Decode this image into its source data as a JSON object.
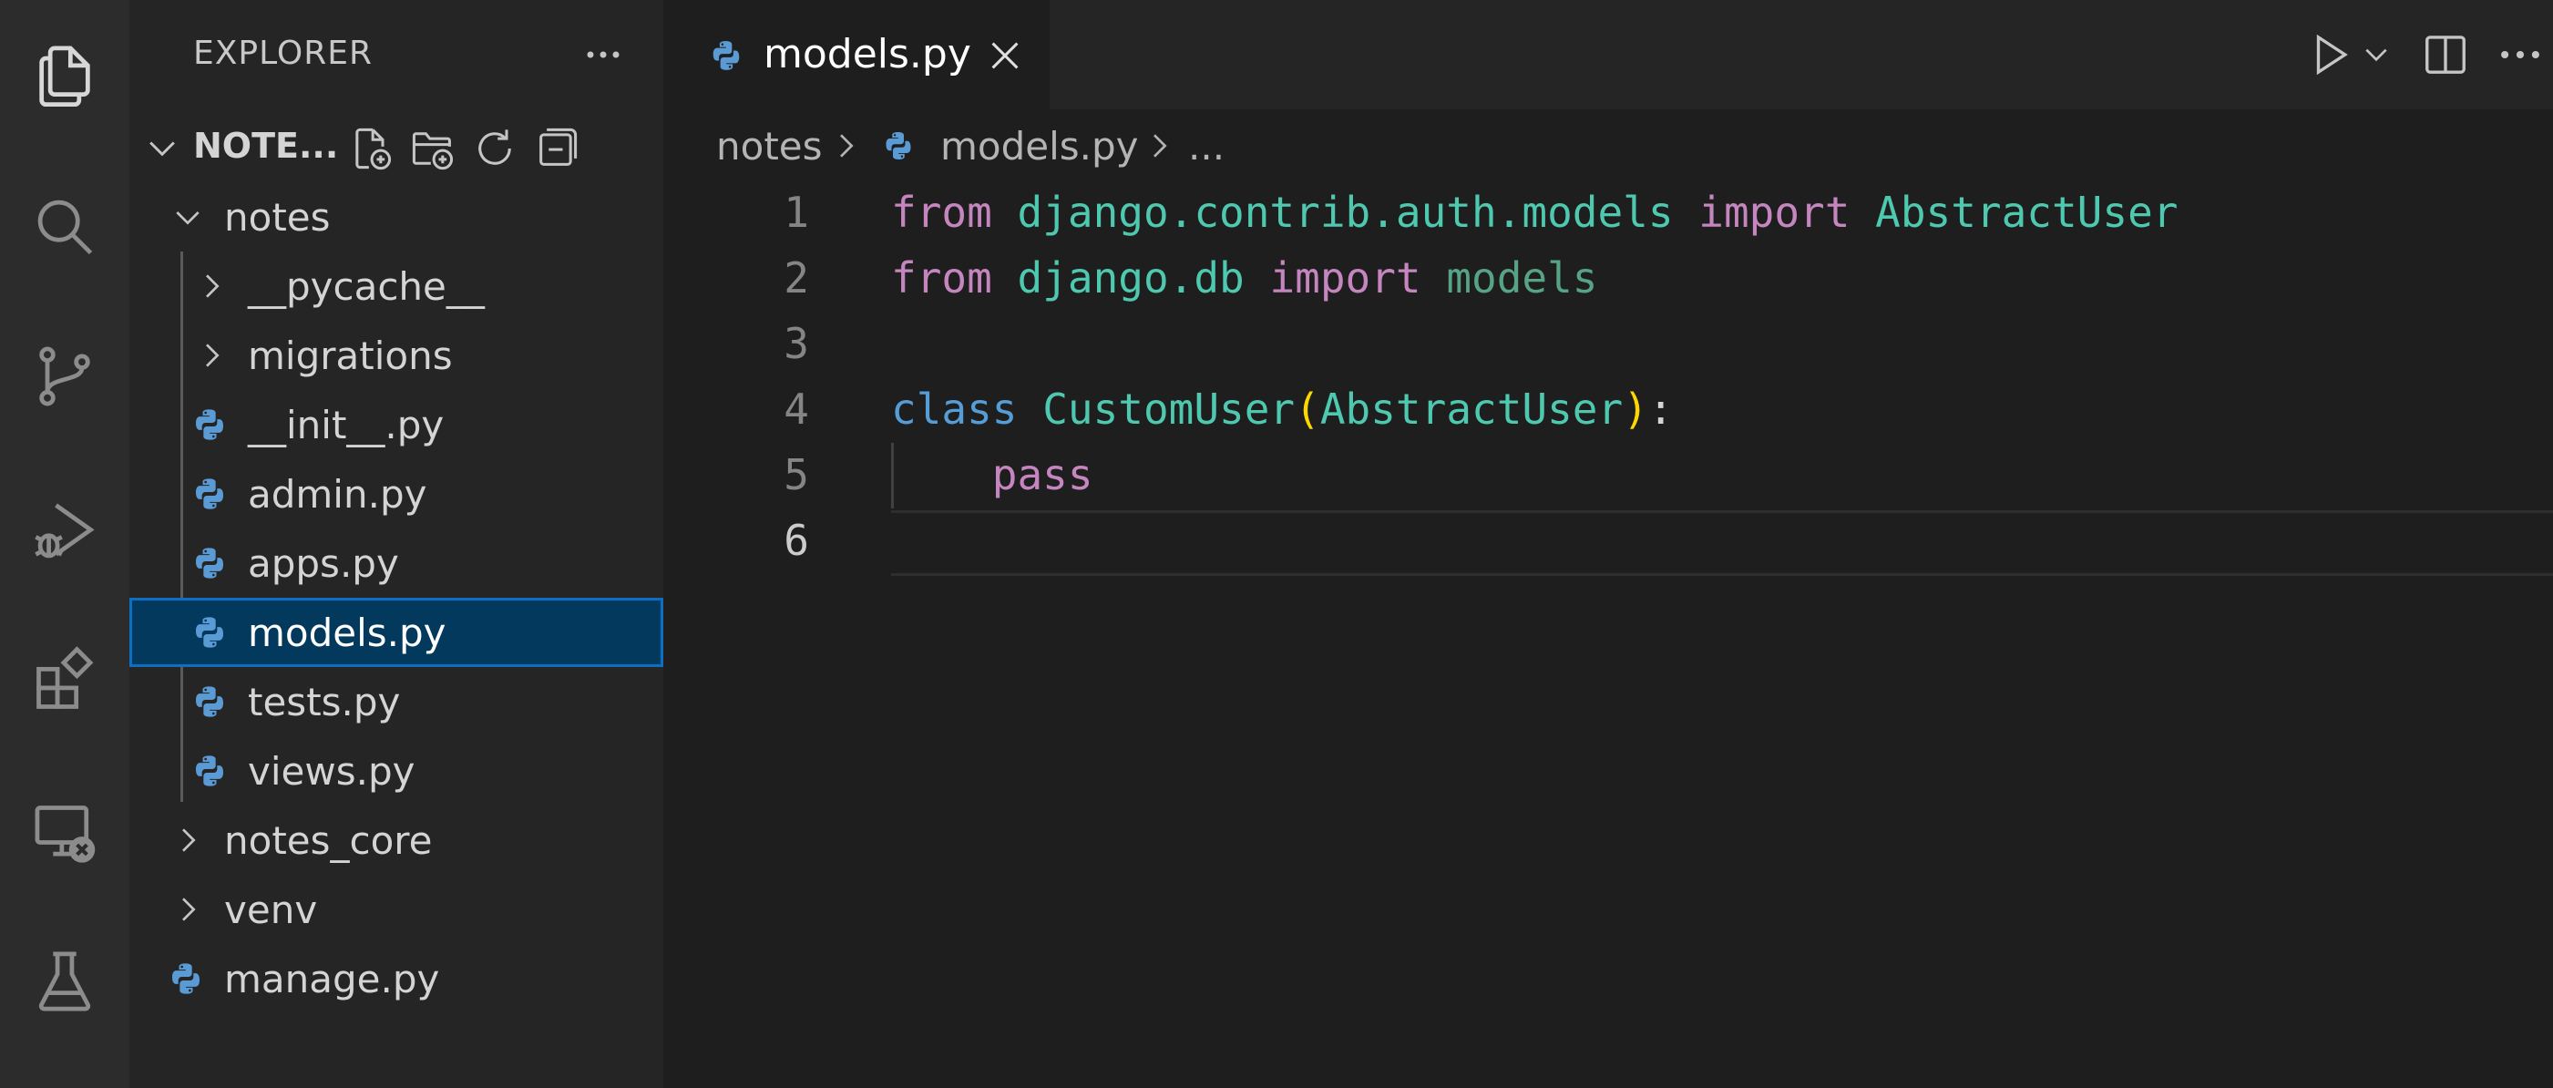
{
  "sidebar": {
    "title": "EXPLORER",
    "section_title": "NOTE...",
    "tree": [
      {
        "label": "notes",
        "type": "folder-open"
      },
      {
        "label": "__pycache__",
        "type": "folder"
      },
      {
        "label": "migrations",
        "type": "folder"
      },
      {
        "label": "__init__.py",
        "type": "python-file"
      },
      {
        "label": "admin.py",
        "type": "python-file"
      },
      {
        "label": "apps.py",
        "type": "python-file"
      },
      {
        "label": "models.py",
        "type": "python-file",
        "selected": true
      },
      {
        "label": "tests.py",
        "type": "python-file"
      },
      {
        "label": "views.py",
        "type": "python-file"
      },
      {
        "label": "notes_core",
        "type": "folder"
      },
      {
        "label": "venv",
        "type": "folder"
      },
      {
        "label": "manage.py",
        "type": "python-file"
      }
    ]
  },
  "editor": {
    "active_tab": "models.py",
    "breadcrumb": [
      "notes",
      "models.py",
      "..."
    ],
    "lines": [
      {
        "number": "1",
        "tokens": [
          "from",
          "django.contrib.auth.models",
          "import",
          "AbstractUser"
        ]
      },
      {
        "number": "2",
        "tokens": [
          "from",
          "django.db",
          "import",
          "models"
        ]
      },
      {
        "number": "3",
        "tokens": []
      },
      {
        "number": "4",
        "tokens": [
          "class",
          "CustomUser",
          "(",
          "AbstractUser",
          ")",
          ":"
        ]
      },
      {
        "number": "5",
        "tokens": [
          "pass"
        ]
      },
      {
        "number": "6",
        "tokens": []
      }
    ]
  },
  "colors": {
    "selection": "#04395e",
    "keyword_control": "#c586c0",
    "keyword_decl": "#569cd6",
    "type": "#4ec9b0",
    "paren": "#ffd700"
  },
  "icons": {
    "activity_bar": [
      "explorer-icon",
      "search-icon",
      "source-control-icon",
      "run-debug-icon",
      "extensions-icon",
      "remote-explorer-icon",
      "testing-icon"
    ],
    "explorer_actions": [
      "new-file-icon",
      "new-folder-icon",
      "refresh-icon",
      "collapse-all-icon"
    ],
    "editor_actions": [
      "run-icon",
      "run-dropdown-icon",
      "split-editor-icon",
      "more-actions-icon"
    ]
  }
}
